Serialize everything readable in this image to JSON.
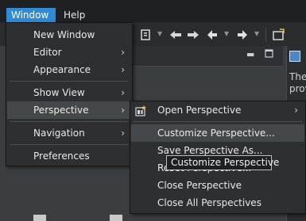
{
  "menubar": {
    "items": [
      {
        "label": "Window",
        "active": true
      },
      {
        "label": "Help"
      }
    ]
  },
  "right_panel": {
    "text_lines": [
      "The",
      "prov"
    ]
  },
  "window_menu": {
    "items": [
      {
        "label": "New Window",
        "submenu": false
      },
      {
        "label": "Editor",
        "submenu": true
      },
      {
        "label": "Appearance",
        "submenu": true
      },
      {
        "label": "Show View",
        "submenu": true
      },
      {
        "label": "Perspective",
        "submenu": true,
        "selected": true
      },
      {
        "label": "Navigation",
        "submenu": true
      },
      {
        "label": "Preferences",
        "submenu": false
      }
    ]
  },
  "perspective_menu": {
    "items": [
      {
        "label": "Open Perspective",
        "submenu": true,
        "icon": "open-perspective-icon"
      },
      {
        "label": "Customize Perspective...",
        "hover": true
      },
      {
        "label": "Save Perspective As..."
      },
      {
        "label": "Reset Perspective..."
      },
      {
        "label": "Close Perspective"
      },
      {
        "label": "Close All Perspectives"
      }
    ]
  },
  "tooltip": {
    "text": "Customize Perspective"
  },
  "colors": {
    "menubar_bg": "#1f2022",
    "menubar_active": "#2f8bd6",
    "menu_bg": "#2d2f31",
    "menu_selected": "#45484b",
    "workbench_bg": "#3b3e41"
  }
}
